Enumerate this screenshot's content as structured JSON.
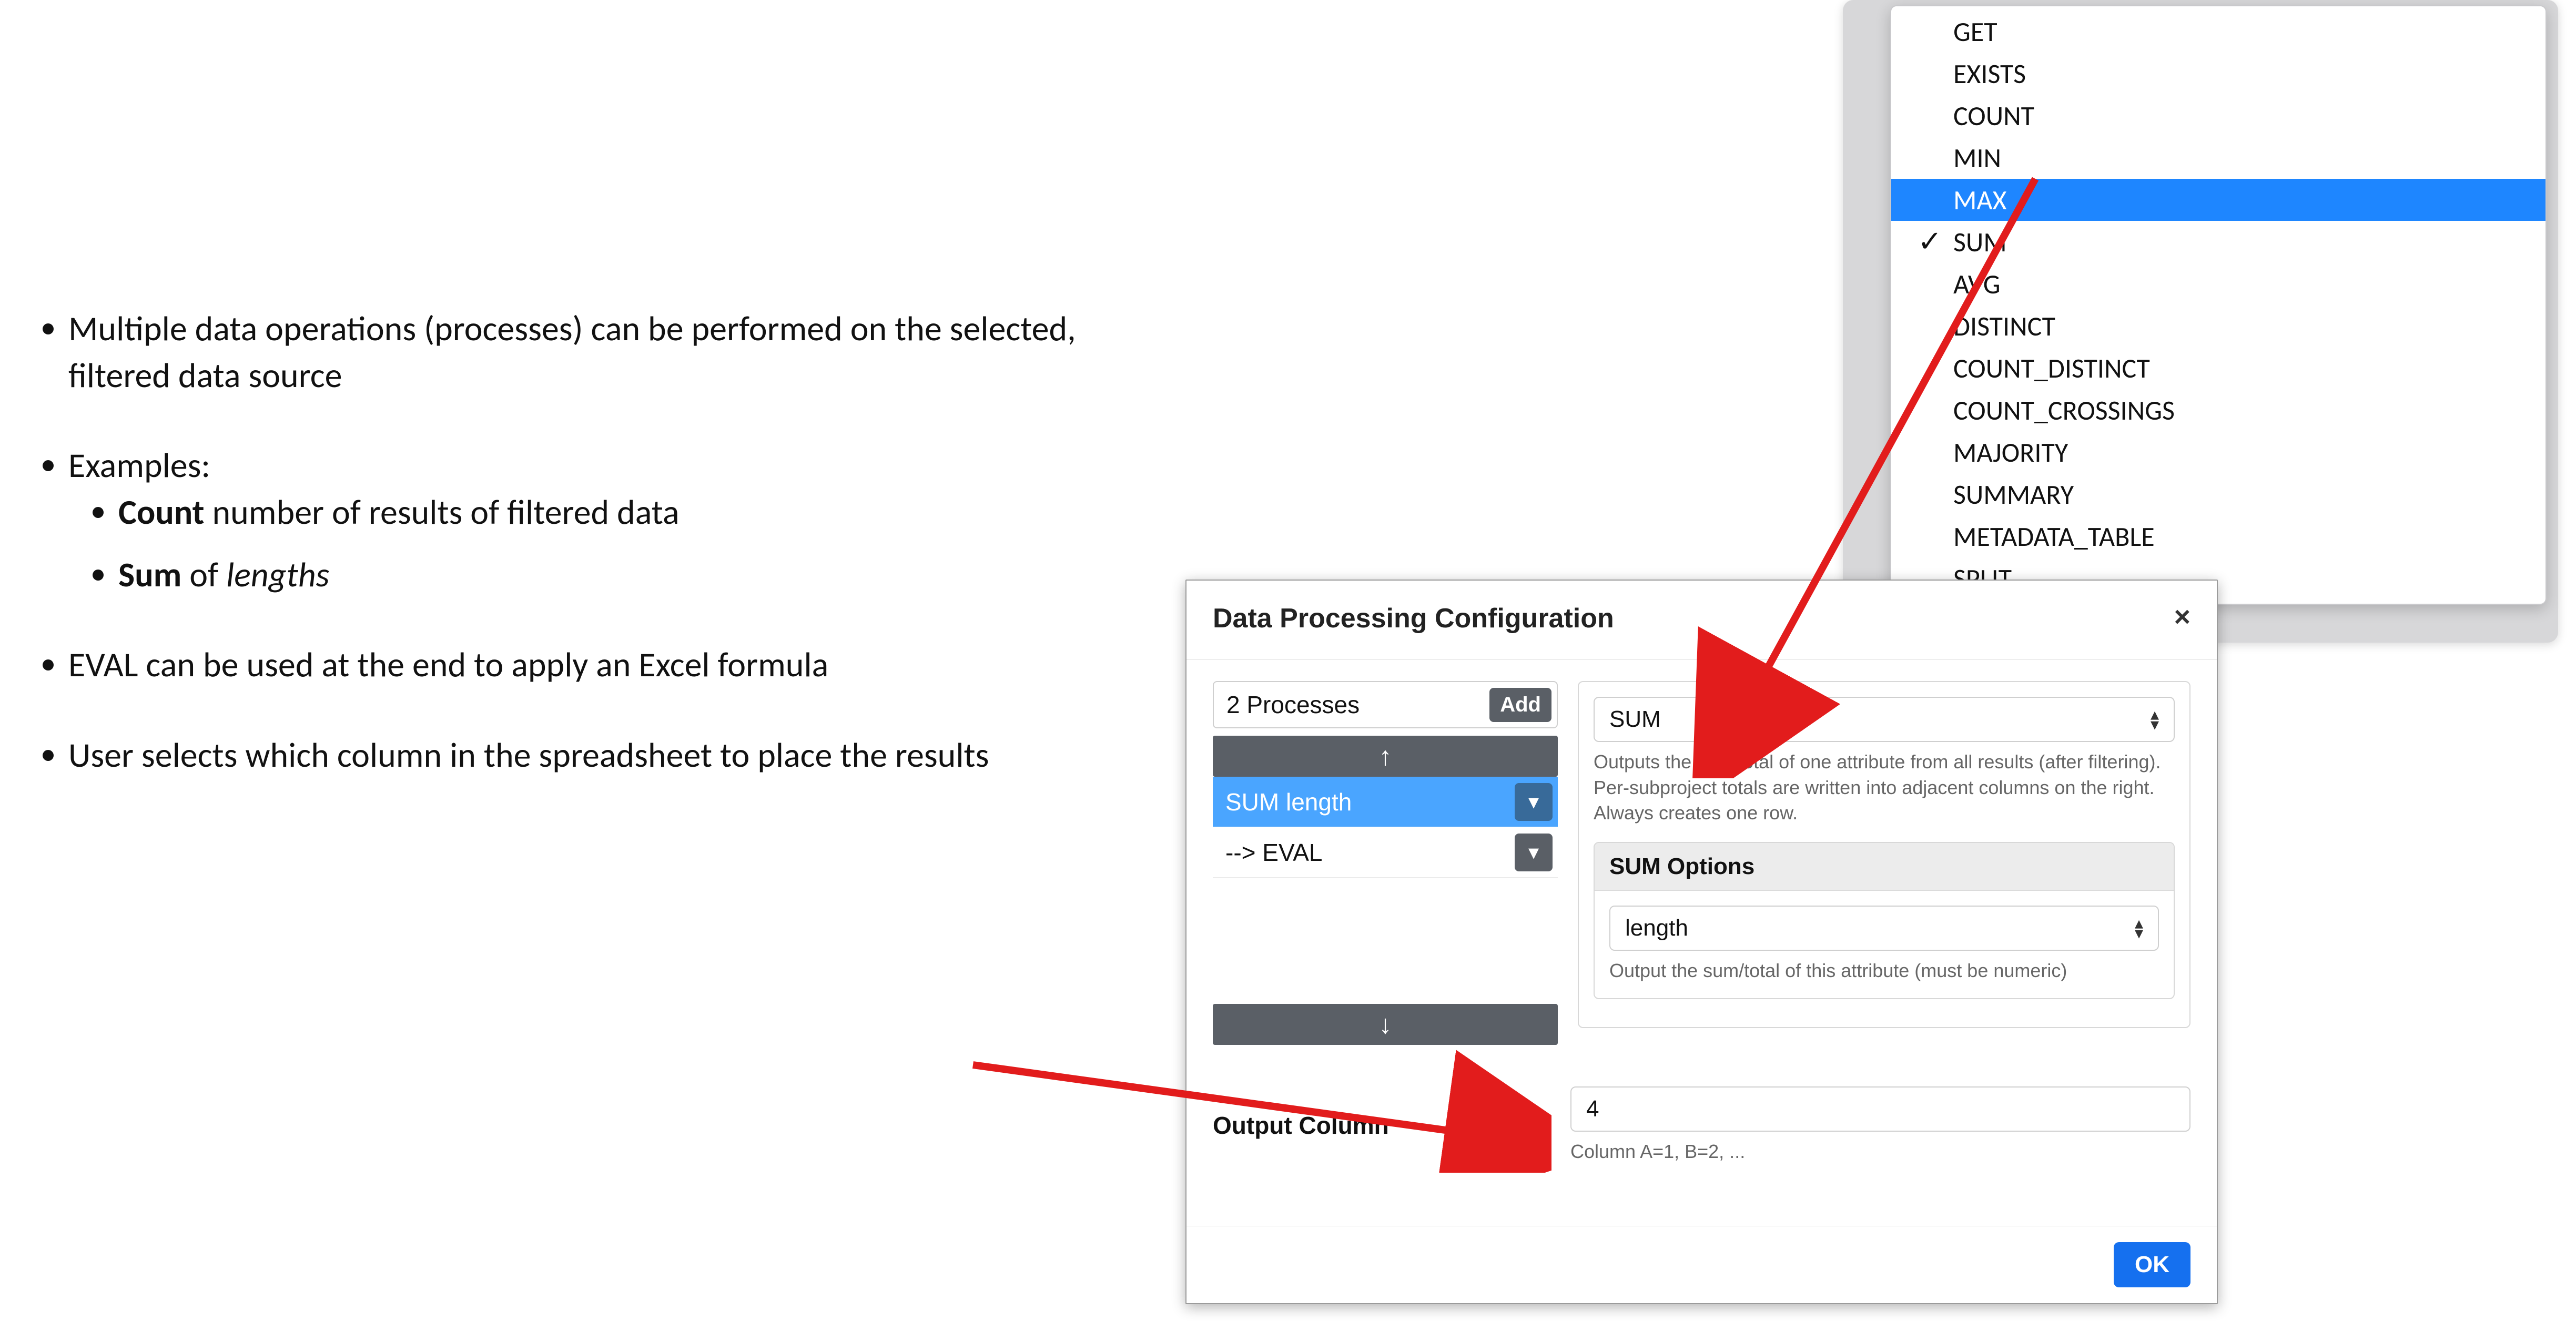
{
  "notes": {
    "b1": "Multiple data operations (processes) can be performed on the selected, filtered data source",
    "b2": "Examples:",
    "b2a_bold": "Count",
    "b2a_rest": " number of results of filtered data",
    "b2b_bold": "Sum",
    "b2b_mid": " of ",
    "b2b_ital": "lengths",
    "b3": "EVAL can be used at the end to apply an Excel formula",
    "b4": "User selects which column in the spreadsheet to place the results"
  },
  "dropdown": {
    "items": [
      {
        "label": "GET",
        "check": false,
        "hl": false
      },
      {
        "label": "EXISTS",
        "check": false,
        "hl": false
      },
      {
        "label": "COUNT",
        "check": false,
        "hl": false
      },
      {
        "label": "MIN",
        "check": false,
        "hl": false
      },
      {
        "label": "MAX",
        "check": false,
        "hl": true
      },
      {
        "label": "SUM",
        "check": true,
        "hl": false
      },
      {
        "label": "AVG",
        "check": false,
        "hl": false
      },
      {
        "label": "DISTINCT",
        "check": false,
        "hl": false
      },
      {
        "label": "COUNT_DISTINCT",
        "check": false,
        "hl": false
      },
      {
        "label": "COUNT_CROSSINGS",
        "check": false,
        "hl": false
      },
      {
        "label": "MAJORITY",
        "check": false,
        "hl": false
      },
      {
        "label": "SUMMARY",
        "check": false,
        "hl": false
      },
      {
        "label": "METADATA_TABLE",
        "check": false,
        "hl": false
      },
      {
        "label": "SPLIT",
        "check": false,
        "hl": false
      }
    ]
  },
  "dialog": {
    "title": "Data Processing Configuration",
    "close": "×",
    "processes_label": "2 Processes",
    "add_label": "Add",
    "arrow_up": "↑",
    "arrow_down": "↓",
    "items": [
      {
        "label": "SUM length",
        "active": true
      },
      {
        "label": "--> EVAL",
        "active": false
      }
    ],
    "type_select": "SUM",
    "type_hint": "Outputs the sum/total of one attribute from all results (after filtering). Per-subproject totals are written into adjacent columns on the right. Always creates one row.",
    "options_title": "SUM Options",
    "attr_select": "length",
    "attr_hint": "Output the sum/total of this attribute (must be numeric)",
    "output_label": "Output Column",
    "output_value": "4",
    "output_hint": "Column A=1, B=2, ...",
    "ok": "OK"
  },
  "glyphs": {
    "check": "✓",
    "chevdown": "▾",
    "updown": "⇅"
  }
}
